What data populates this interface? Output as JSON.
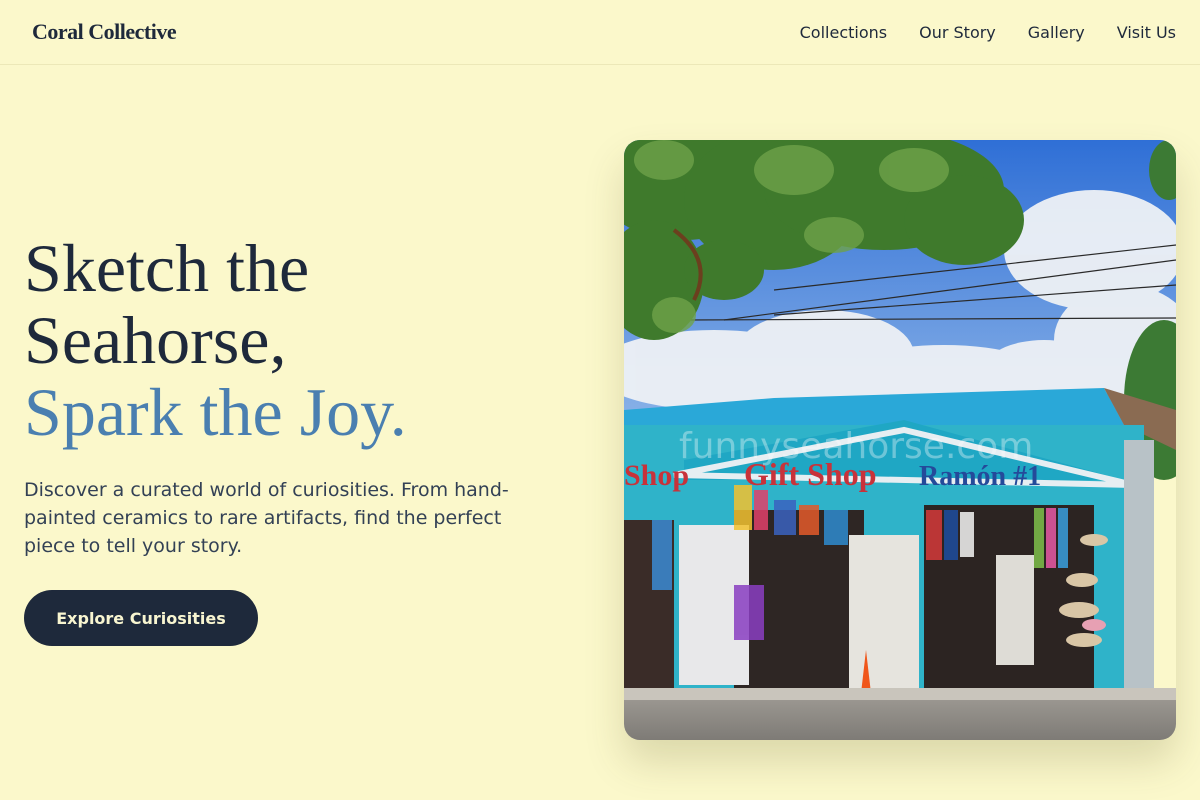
{
  "header": {
    "logo": "Coral Collective",
    "nav": [
      {
        "label": "Collections"
      },
      {
        "label": "Our Story"
      },
      {
        "label": "Gallery"
      },
      {
        "label": "Visit Us"
      }
    ]
  },
  "hero": {
    "headline_line1": "Sketch the",
    "headline_line2": "Seahorse,",
    "headline_accent": "Spark the Joy.",
    "description": "Discover a curated world of curiosities. From hand-painted ceramics to rare artifacts, find the perfect piece to tell your story.",
    "cta_label": "Explore Curiosities"
  },
  "photo": {
    "sign_left": "Shop",
    "sign_center": "Gift Shop",
    "sign_right": "Ramón #1",
    "watermark": "funnyseahorse.com"
  },
  "colors": {
    "background": "#fbf8cb",
    "text": "#1e293b",
    "accent": "#4a7fb0",
    "button": "#1e293b"
  }
}
